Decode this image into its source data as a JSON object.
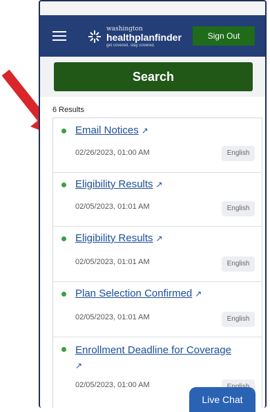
{
  "app": {
    "logo_small": "washington",
    "logo_main": "healthplanfinder",
    "logo_tagline": "get covered. stay covered.",
    "signout_label": "Sign Out"
  },
  "search": {
    "label": "Search"
  },
  "results": {
    "count_label": "6 Results",
    "items": [
      {
        "title": "Email Notices",
        "date": "02/26/2023, 01:00 AM",
        "lang": "English"
      },
      {
        "title": "Eligibility Results",
        "date": "02/05/2023, 01:01 AM",
        "lang": "English"
      },
      {
        "title": "Eligibility Results",
        "date": "02/05/2023, 01:01 AM",
        "lang": "English"
      },
      {
        "title": "Plan Selection Confirmed",
        "date": "02/05/2023, 01:01 AM",
        "lang": "English"
      },
      {
        "title": "Enrollment Deadline for Coverage",
        "date": "02/05/2023, 01:00 AM",
        "lang": "English"
      }
    ]
  },
  "live_chat": {
    "label": "Live Chat"
  },
  "icons": {
    "external": "external-link-icon",
    "menu": "hamburger-menu-icon"
  },
  "colors": {
    "nav": "#243e77",
    "primary_green": "#215717",
    "link": "#1d4f9a",
    "status_dot": "#3aa040",
    "annotation_arrow": "#d9262b"
  }
}
